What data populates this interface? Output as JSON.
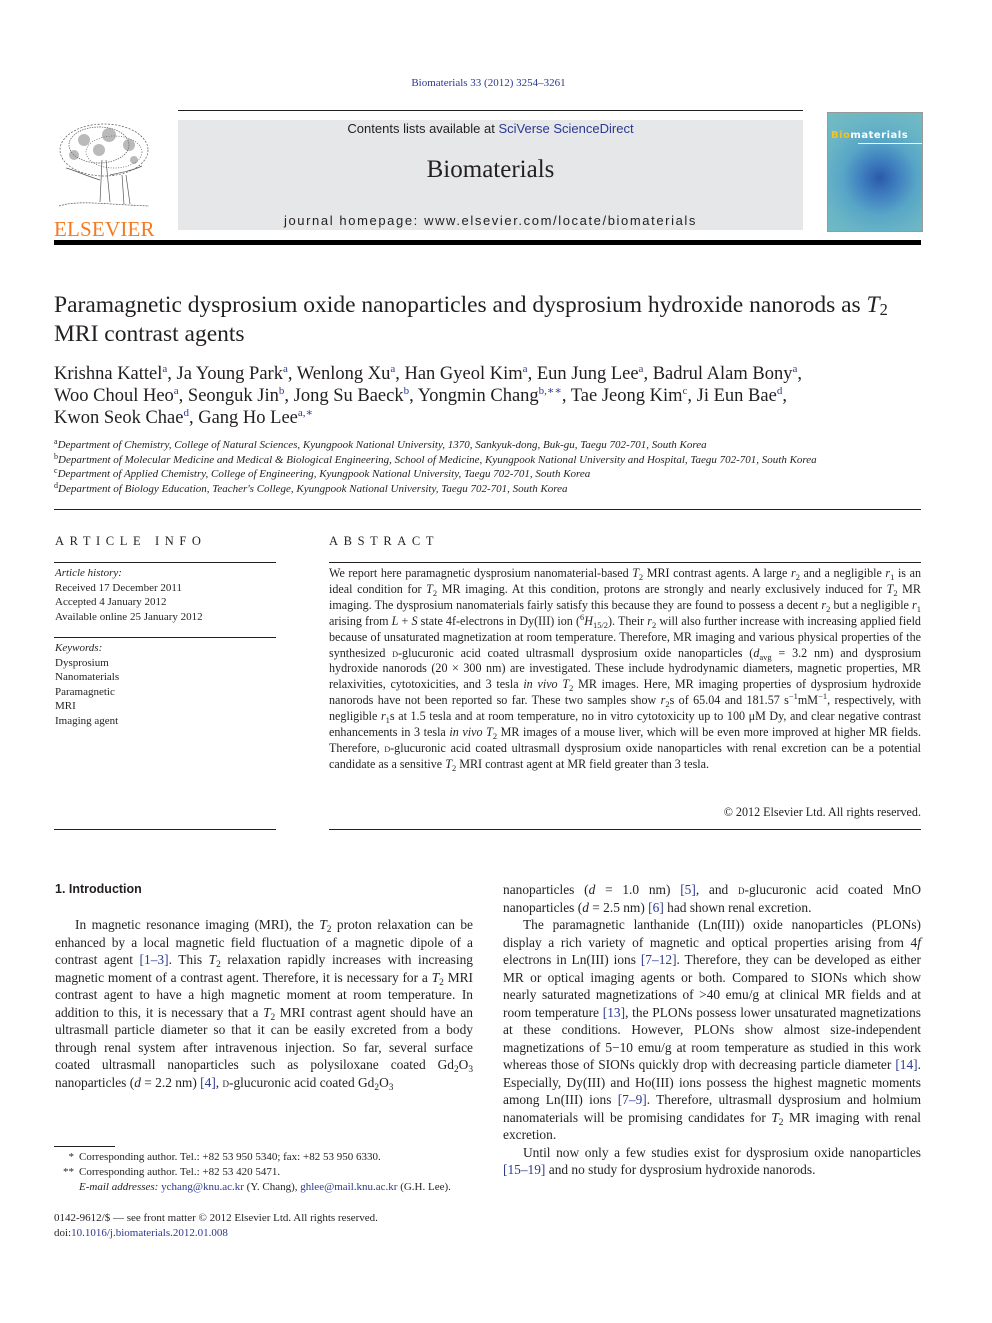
{
  "citation": "Biomaterials 33 (2012) 3254–3261",
  "header": {
    "publisher_logo_text": "ELSEVIER",
    "contents_prefix": "Contents lists available at ",
    "contents_link": "SciVerse ScienceDirect",
    "journal_name": "Biomaterials",
    "homepage": "journal homepage: www.elsevier.com/locate/biomaterials",
    "cover_title_highlight": "Bio",
    "cover_title_rest": "materials"
  },
  "article": {
    "title_part1": "Paramagnetic dysprosium oxide nanoparticles and dysprosium hydroxide nanorods as ",
    "title_T": "T",
    "title_sub": "2",
    "title_part2": " MRI contrast agents",
    "authors": [
      {
        "name": "Krishna Kattel",
        "aff": "a",
        "sep": ", "
      },
      {
        "name": "Ja Young Park",
        "aff": "a",
        "sep": ", "
      },
      {
        "name": "Wenlong Xu",
        "aff": "a",
        "sep": ", "
      },
      {
        "name": "Han Gyeol Kim",
        "aff": "a",
        "sep": ", "
      },
      {
        "name": "Eun Jung Lee",
        "aff": "a",
        "sep": ", "
      },
      {
        "name": "Badrul Alam Bony",
        "aff": "a",
        "sep": ","
      },
      {
        "name": "Woo Choul Heo",
        "aff": "a",
        "sep": ", "
      },
      {
        "name": "Seonguk Jin",
        "aff": "b",
        "sep": ", "
      },
      {
        "name": "Jong Su Baeck",
        "aff": "b",
        "sep": ", "
      },
      {
        "name": "Yongmin Chang",
        "aff": "b,∗∗",
        "sep": ", "
      },
      {
        "name": "Tae Jeong Kim",
        "aff": "c",
        "sep": ", "
      },
      {
        "name": "Ji Eun Bae",
        "aff": "d",
        "sep": ","
      },
      {
        "name": "Kwon Seok Chae",
        "aff": "d",
        "sep": ", "
      },
      {
        "name": "Gang Ho Lee",
        "aff": "a,∗",
        "sep": ""
      }
    ],
    "affiliations": [
      {
        "mark": "a",
        "text": "Department of Chemistry, College of Natural Sciences, Kyungpook National University, 1370, Sankyuk-dong, Buk-gu, Taegu 702-701, South Korea"
      },
      {
        "mark": "b",
        "text": "Department of Molecular Medicine and Medical & Biological Engineering, School of Medicine, Kyungpook National University and Hospital, Taegu 702-701, South Korea"
      },
      {
        "mark": "c",
        "text": "Department of Applied Chemistry, College of Engineering, Kyungpook National University, Taegu 702-701, South Korea"
      },
      {
        "mark": "d",
        "text": "Department of Biology Education, Teacher's College, Kyungpook National University, Taegu 702-701, South Korea"
      }
    ]
  },
  "article_info": {
    "heading": "ARTICLE INFO",
    "history_label": "Article history:",
    "received": "Received 17 December 2011",
    "accepted": "Accepted 4 January 2012",
    "online": "Available online 25 January 2012",
    "keywords_label": "Keywords:",
    "keywords": [
      "Dysprosium",
      "Nanomaterials",
      "Paramagnetic",
      "MRI",
      "Imaging agent"
    ]
  },
  "abstract": {
    "heading": "ABSTRACT",
    "copyright": "© 2012 Elsevier Ltd. All rights reserved."
  },
  "intro": {
    "heading": "1.  Introduction"
  },
  "footnotes": {
    "fn1_mark": "*",
    "fn1_text": "Corresponding author. Tel.: +82 53 950 5340; fax: +82 53 950 6330.",
    "fn2_mark": "**",
    "fn2_text": "Corresponding author. Tel.: +82 53 420 5471.",
    "email_label": "E-mail addresses:",
    "email1": "ychang@knu.ac.kr",
    "email1_name": " (Y. Chang), ",
    "email2": "ghlee@mail.knu.ac.kr",
    "email2_name": " (G.H. Lee).",
    "front_matter": "0142-9612/$ — see front matter © 2012 Elsevier Ltd. All rights reserved.",
    "doi_label": "doi:",
    "doi": "10.1016/j.biomaterials.2012.01.008"
  }
}
